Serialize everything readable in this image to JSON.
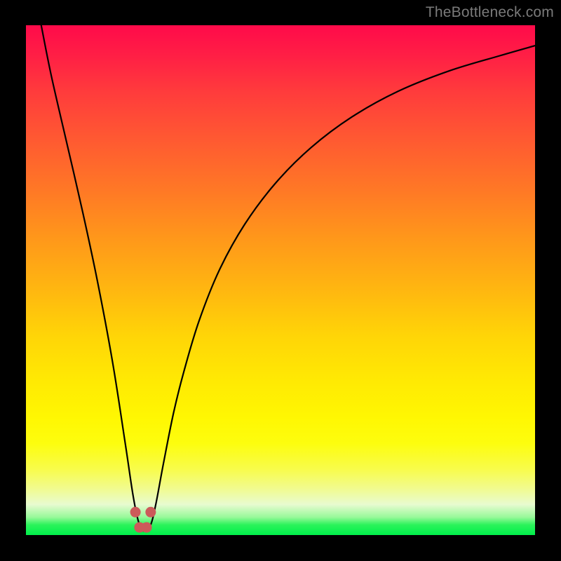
{
  "watermark": "TheBottleneck.com",
  "chart_data": {
    "type": "line",
    "title": "",
    "xlabel": "",
    "ylabel": "",
    "xlim": [
      0,
      100
    ],
    "ylim": [
      0,
      100
    ],
    "grid": false,
    "legend": false,
    "series": [
      {
        "name": "curve",
        "x": [
          3,
          5,
          8,
          11,
          14,
          17,
          19.5,
          21,
          22,
          22.8,
          23.5,
          24.5,
          25.5,
          27,
          29,
          31,
          34,
          38,
          43,
          49,
          56,
          64,
          73,
          83,
          93,
          100
        ],
        "y": [
          100,
          90,
          77,
          64,
          50,
          34,
          18,
          8,
          3,
          1,
          1,
          2,
          6,
          14,
          24,
          32,
          42,
          52,
          61,
          69,
          76,
          82,
          87,
          91,
          94,
          96
        ]
      }
    ],
    "markers": {
      "name": "highlight-nodes",
      "color": "#cc5a5a",
      "points": [
        {
          "x": 21.5,
          "y": 4.5
        },
        {
          "x": 22.3,
          "y": 1.5
        },
        {
          "x": 23.7,
          "y": 1.5
        },
        {
          "x": 24.5,
          "y": 4.5
        }
      ]
    },
    "background": {
      "type": "vertical-gradient",
      "stops": [
        {
          "pos": 0,
          "color": "#ff0a4a"
        },
        {
          "pos": 70,
          "color": "#ffea03"
        },
        {
          "pos": 100,
          "color": "#00ef4b"
        }
      ]
    }
  }
}
